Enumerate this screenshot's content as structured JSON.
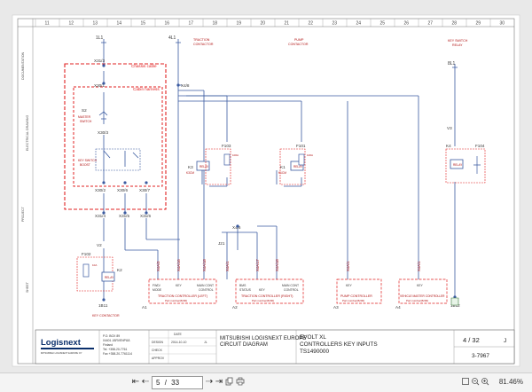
{
  "column_numbers": [
    "11",
    "12",
    "13",
    "14",
    "15",
    "16",
    "17",
    "18",
    "19",
    "20",
    "21",
    "22",
    "23",
    "24",
    "25",
    "26",
    "27",
    "28",
    "29",
    "30"
  ],
  "top_labels": {
    "traction_contactor": [
      "TRACTION",
      "CONTACTOR"
    ],
    "pump_contactor": [
      "PUMP",
      "CONTACTOR"
    ],
    "key_switch_relay": [
      "KEY SWITCH",
      "RELAY"
    ]
  },
  "terminals": {
    "t1": "1L1",
    "t2": "4L1",
    "t3": "8L1",
    "x31_3": "X31/3",
    "x30_1": "X30/1",
    "x30_3": "X30/3",
    "x30_2": "X30/2",
    "x30_6": "X30/6",
    "x30_7": "X30/7",
    "x31_4": "X31/4",
    "x31_5": "X31/5",
    "x31_6": "X31/6",
    "x4_8": "X4/8",
    "x4_6": "X4/6",
    "j21": "J21",
    "v2": "V2",
    "v3": "V3",
    "b11": "1B11",
    "b12": "1B12"
  },
  "boxes": {
    "chassis": "Chassis cable",
    "cabin": "Cabin harness"
  },
  "components": {
    "s2_label": "S2",
    "s2_desc": [
      "MASTER",
      "SWITCH"
    ],
    "key_switch_desc": [
      "KEY SWITCH",
      "BOOST"
    ],
    "k3": "K3",
    "k3_sub": "K3CM",
    "k1": "K1",
    "k1_sub": "K1CM",
    "k4": "K4",
    "k2": "K2",
    "f103": "F103",
    "f101": "F101",
    "f102": "F102",
    "f104": "F104",
    "relay_text": "RELAY",
    "fuse_value": "100A",
    "fuse_value2": "10A",
    "key_contactor": "KEY CONTACTOR"
  },
  "wire_labels": [
    "X4A/3",
    "X4A/16",
    "X4A/18",
    "X4A/1",
    "X4A/17",
    "X4A/18",
    "X4A/1",
    "X4A/1"
  ],
  "controllers": [
    {
      "id": "A1",
      "lines": [
        "FWD/",
        "KEY",
        "MAIN CONT"
      ],
      "sub": [
        "MODE",
        "",
        "CONTROL"
      ],
      "title": "TRACTION CONTROLLER (LEFT)",
      "part": "Part number(8200)"
    },
    {
      "id": "A2",
      "lines": [
        "BMS",
        "KEY",
        "MAIN CONT"
      ],
      "sub": [
        "STATUS",
        "",
        "CONTROL"
      ],
      "title": "TRACTION CONTROLLER (RIGHT)",
      "part": "Part number(8200)"
    },
    {
      "id": "A3",
      "lines": [
        "KEY"
      ],
      "sub": [
        ""
      ],
      "title": "PUMP CONTROLLER",
      "part": "Part number(8200)"
    },
    {
      "id": "A4",
      "lines": [
        "KEY"
      ],
      "sub": [
        ""
      ],
      "title": "VEHICLE MASTER CONTROLLER",
      "part": "Part number(8200)"
    }
  ],
  "title_block": {
    "company_logo": "Logisnext",
    "tagline": "MITSUBISHI LOGISNEXT EUROPE OY",
    "address": [
      "P.O. BOX 89",
      "04401 JÄRVENPÄÄ",
      "Finland",
      "Tel. +358-20-7761",
      "Fax +358-20-7761114"
    ],
    "meta_labels": [
      "DESIGN",
      "CHECK",
      "APPROV"
    ],
    "date_label": "DATE",
    "date": "2014-10-10",
    "initials": "JL",
    "company": "MITSUBISHI LOGISNEXT EUROPE",
    "doc_type": "CIRCUIT DIAGRAM",
    "model": "EVOLT XL",
    "subject": "CONTROLLERS KEY INPUTS",
    "doc_number": "TS1490000",
    "page": "4 / 32",
    "rev": "J",
    "drawing_no": "3-7967"
  },
  "side_notes": [
    "DOCUMENTATION",
    "ELECTRICAL DRAWING",
    "PROJECT",
    "SHEET"
  ],
  "toolbar": {
    "first": "⇤",
    "prev": "⇠",
    "page_current": "5",
    "page_sep": "/",
    "page_total": "33",
    "next": "⇢",
    "last": "⇥",
    "zoom": "81.46%"
  },
  "colors": {
    "wire": "#3a5aa0",
    "red_dash": "#e02020",
    "frame": "#555555"
  }
}
